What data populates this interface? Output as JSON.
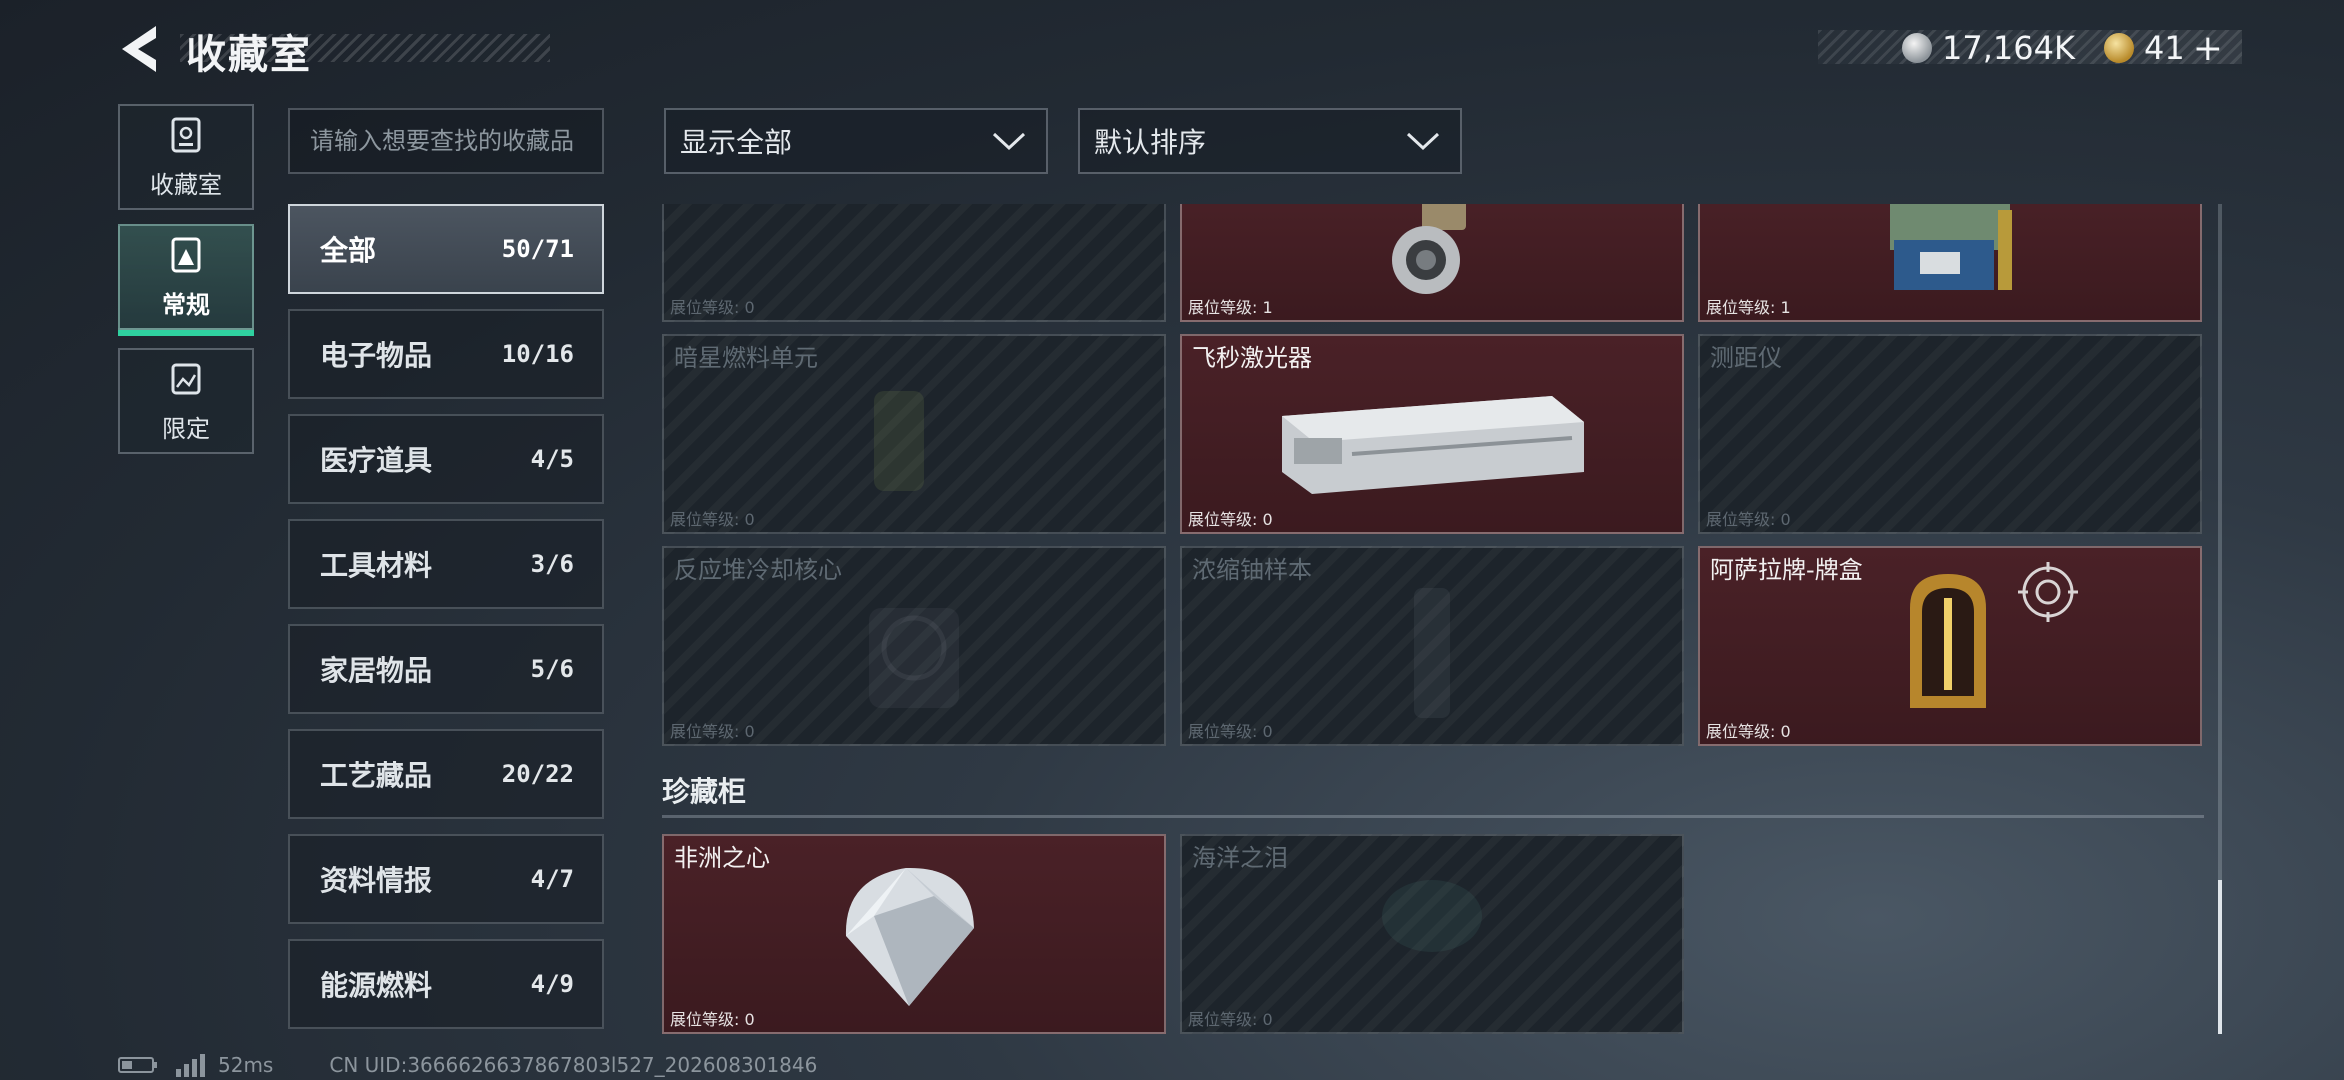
{
  "header": {
    "title": "收藏室",
    "currencies": [
      {
        "icon": "silver-coin-icon",
        "value": "17,164K"
      },
      {
        "icon": "gold-triangle-coin-icon",
        "value": "41"
      }
    ],
    "add_label": "+"
  },
  "left_tabs": [
    {
      "label": "收藏室",
      "icon": "collection-room-icon"
    },
    {
      "label": "常规",
      "icon": "regular-display-icon",
      "active": true
    },
    {
      "label": "限定",
      "icon": "limited-display-icon"
    }
  ],
  "search": {
    "placeholder": "请输入想要查找的收藏品"
  },
  "categories": [
    {
      "name": "全部",
      "count": "50/71",
      "active": true
    },
    {
      "name": "电子物品",
      "count": "10/16"
    },
    {
      "name": "医疗道具",
      "count": "4/5"
    },
    {
      "name": "工具材料",
      "count": "3/6"
    },
    {
      "name": "家居物品",
      "count": "5/6"
    },
    {
      "name": "工艺藏品",
      "count": "20/22"
    },
    {
      "name": "资料情报",
      "count": "4/7"
    },
    {
      "name": "能源燃料",
      "count": "4/9"
    }
  ],
  "filters": {
    "show": "显示全部",
    "sort": "默认排序"
  },
  "items_top": [
    {
      "name": "",
      "level": "展位等级: 0",
      "owned": false
    },
    {
      "name": "",
      "level": "展位等级: 1",
      "owned": true
    },
    {
      "name": "",
      "level": "展位等级: 1",
      "owned": true
    },
    {
      "name": "暗星燃料单元",
      "level": "展位等级: 0",
      "owned": false
    },
    {
      "name": "飞秒激光器",
      "level": "展位等级: 0",
      "owned": true
    },
    {
      "name": "测距仪",
      "level": "展位等级: 0",
      "owned": false
    },
    {
      "name": "反应堆冷却核心",
      "level": "展位等级: 0",
      "owned": false
    },
    {
      "name": "浓缩铀样本",
      "level": "展位等级: 0",
      "owned": false
    },
    {
      "name": "阿萨拉牌-牌盒",
      "level": "展位等级: 0",
      "owned": true
    }
  ],
  "section_title": "珍藏柜",
  "items_bottom": [
    {
      "name": "非洲之心",
      "level": "展位等级: 0",
      "owned": true
    },
    {
      "name": "海洋之泪",
      "level": "展位等级: 0",
      "owned": false
    }
  ],
  "footer": {
    "ping": "52ms",
    "uid": "CN UID:3666626637867803l527_202608301846"
  },
  "colors": {
    "accent_green": "#2fd1a0",
    "owned_card": "#4a2127",
    "locked_card": "#1d242b"
  }
}
